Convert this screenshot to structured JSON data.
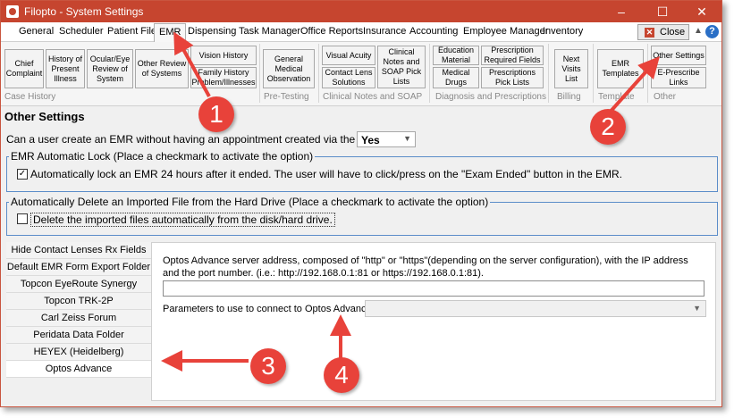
{
  "window": {
    "title": "Filopto - System Settings",
    "controls": {
      "minimize": "–",
      "maximize": "☐",
      "close": "✕"
    }
  },
  "menu": {
    "tabs": [
      "General",
      "Scheduler",
      "Patient File",
      "EMR",
      "Dispensing",
      "Task Manager",
      "Office Reports",
      "Insurance",
      "Accounting",
      "Employee Manager",
      "Inventory"
    ],
    "active": "EMR",
    "close_label": "Close",
    "help": "?"
  },
  "ribbon": {
    "buttons": {
      "chief_complaint": "Chief Complaint",
      "history_present_illness": "History of Present Illness",
      "ocular_eye_review": "Ocular/Eye Review of System",
      "other_review": "Other Review of Systems",
      "vision_history": "Vision History",
      "family_history": "Family History Problem/Illnesses",
      "general_medical_observation": "General Medical Observation",
      "visual_acuity": "Visual Acuity",
      "contact_lens_solutions": "Contact Lens Solutions",
      "clinical_notes_soap": "Clinical Notes and SOAP Pick Lists",
      "education_material": "Education Material",
      "prescription_required": "Prescription Required Fields",
      "medical_drugs": "Medical Drugs",
      "prescriptions_pick_lists": "Prescriptions Pick Lists",
      "next_visits_list": "Next Visits List",
      "emr_templates": "EMR Templates",
      "other_settings": "Other Settings",
      "e_prescribe_links": "E-Prescribe Links"
    },
    "groups": {
      "case_history": "Case History",
      "pre_testing": "Pre-Testing",
      "clinical_notes": "Clinical Notes and SOAP",
      "diagnosis": "Diagnosis and Prescriptions",
      "billing": "Billing",
      "templates": "Template",
      "other": "Other"
    }
  },
  "content": {
    "heading": "Other Settings",
    "question": "Can a user create an EMR without having an appointment created via the scheduler?",
    "question_value": "Yes",
    "auto_lock": {
      "legend": "EMR Automatic Lock (Place a checkmark to activate the option)",
      "label": "Automatically lock an EMR 24 hours after it ended.  The user will have to click/press on the \"Exam Ended\" button in the EMR.",
      "checked": true
    },
    "auto_delete": {
      "legend": "Automatically Delete an Imported File from the Hard Drive (Place a checkmark to activate the option)",
      "label": "Delete the imported files automatically from the disk/hard drive.",
      "checked": false
    },
    "left_list": [
      "Hide Contact Lenses Rx Fields",
      "Default EMR Form Export Folder",
      "Topcon EyeRoute Synergy",
      "Topcon TRK-2P",
      "Carl Zeiss Forum",
      "Peridata Data Folder",
      "HEYEX (Heidelberg)",
      "Optos Advance"
    ],
    "left_list_selected": "Optos Advance",
    "panel": {
      "description": "Optos Advance server address, composed of \"http\" or \"https\"(depending on the server configuration), with the IP address and the port number. (i.e.: http://192.168.0.1:81  or https://192.168.0.1:81).",
      "address_value": "",
      "params_label": "Parameters to use to connect to Optos Advance",
      "params_value": ""
    }
  },
  "annotations": [
    "1",
    "2",
    "3",
    "4"
  ],
  "colors": {
    "titlebar": "#c6452f",
    "badge": "#e8423a",
    "fieldset_border": "#5b8dc9"
  }
}
